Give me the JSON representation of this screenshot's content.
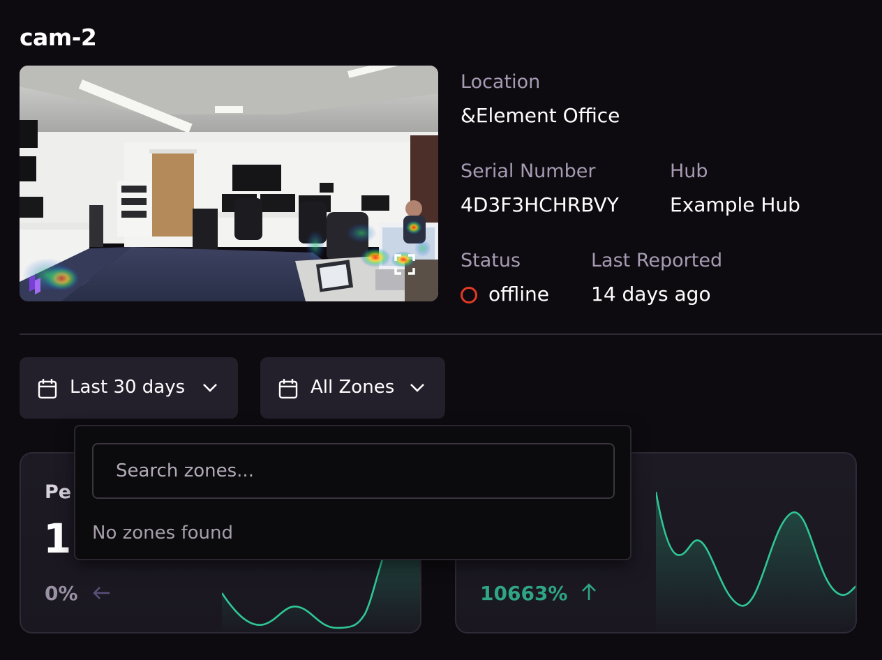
{
  "camera": {
    "name": "cam-2"
  },
  "details": {
    "location_label": "Location",
    "location_value": "&Element Office",
    "serial_label": "Serial Number",
    "serial_value": "4D3F3HCHRBVY",
    "hub_label": "Hub",
    "hub_value": "Example Hub",
    "status_label": "Status",
    "status_value": "offline",
    "status_color": "#e03a24",
    "last_reported_label": "Last Reported",
    "last_reported_value": "14 days ago"
  },
  "filters": {
    "date_range": {
      "label": "Last 30 days",
      "icon": "calendar-icon"
    },
    "zones": {
      "label": "All Zones",
      "icon": "calendar-icon"
    }
  },
  "zone_dropdown": {
    "search_placeholder": "Search zones...",
    "search_value": "",
    "empty_message": "No zones found"
  },
  "cards": [
    {
      "title_visible": "Pe",
      "value_visible": "1",
      "change": "0%",
      "change_direction": "left",
      "change_color": "#9a91a4"
    },
    {
      "change": "10663%",
      "change_direction": "up",
      "change_color": "#2fa585"
    }
  ],
  "colors": {
    "background": "#0e0b10",
    "surface": "#231f2b",
    "accent_green": "#2fc795",
    "muted_text": "#a69bb3"
  }
}
